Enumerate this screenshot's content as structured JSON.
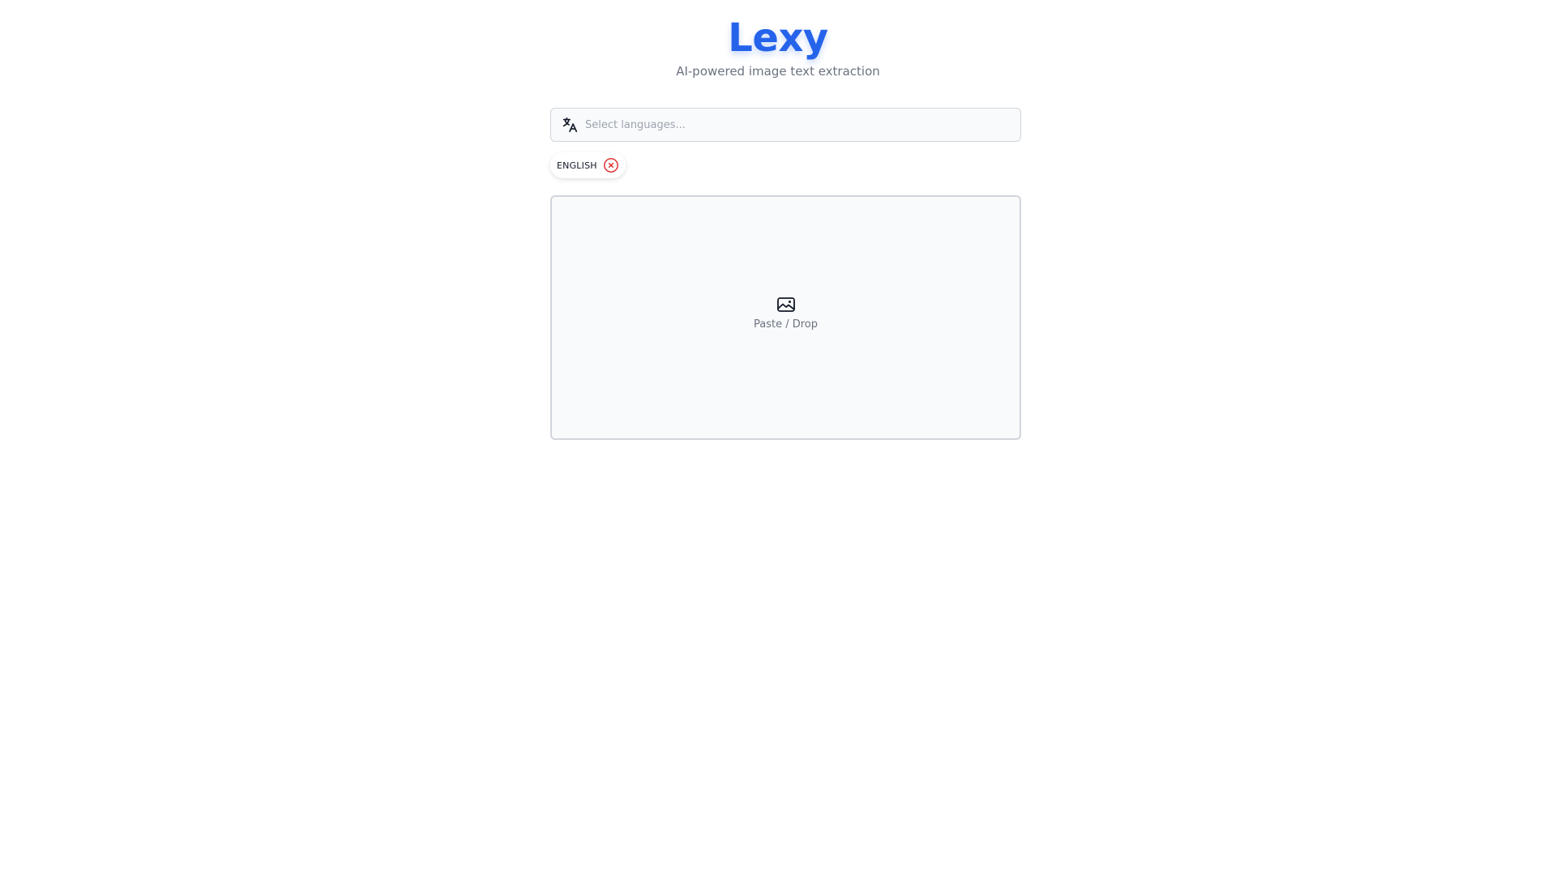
{
  "header": {
    "brand": "Lexy",
    "tagline": "AI-powered image text extraction"
  },
  "language_select": {
    "icon": "translate-icon",
    "placeholder": "Select languages...",
    "value": ""
  },
  "selected_languages": [
    {
      "label": "ENGLISH",
      "remove_icon": "close-circle-icon"
    }
  ],
  "dropzone": {
    "icon": "image-icon",
    "label": "Paste / Drop"
  },
  "colors": {
    "brand": "#2563eb",
    "remove": "#dc2626",
    "muted_text": "#6b7280",
    "border": "#d1d5db",
    "surface": "#f9fafb"
  }
}
